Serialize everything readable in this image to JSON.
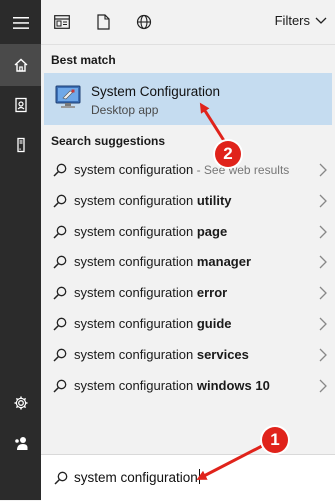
{
  "topbar": {
    "filters_label": "Filters"
  },
  "best_match": {
    "section_label": "Best match",
    "app_name": "System Configuration",
    "app_type": "Desktop app"
  },
  "suggestions": {
    "section_label": "Search suggestions",
    "items": [
      {
        "prefix": "system configuration",
        "bold": "",
        "suffix": " - See web results"
      },
      {
        "prefix": "system configuration ",
        "bold": "utility",
        "suffix": ""
      },
      {
        "prefix": "system configuration ",
        "bold": "page",
        "suffix": ""
      },
      {
        "prefix": "system configuration ",
        "bold": "manager",
        "suffix": ""
      },
      {
        "prefix": "system configuration ",
        "bold": "error",
        "suffix": ""
      },
      {
        "prefix": "system configuration ",
        "bold": "guide",
        "suffix": ""
      },
      {
        "prefix": "system configuration ",
        "bold": "services",
        "suffix": ""
      },
      {
        "prefix": "system configuration ",
        "bold": "windows 10",
        "suffix": ""
      }
    ]
  },
  "search": {
    "value": "system configuration"
  },
  "annotations": {
    "badge_1": "1",
    "badge_2": "2",
    "color": "#e0231b"
  },
  "icons": {
    "rail": [
      "hamburger-icon",
      "home-icon",
      "documents-icon",
      "tower-icon",
      "settings-icon",
      "user-icon"
    ],
    "topbar": [
      "apps-icon",
      "document-icon",
      "web-globe-icon",
      "chevron-down-icon"
    ]
  }
}
